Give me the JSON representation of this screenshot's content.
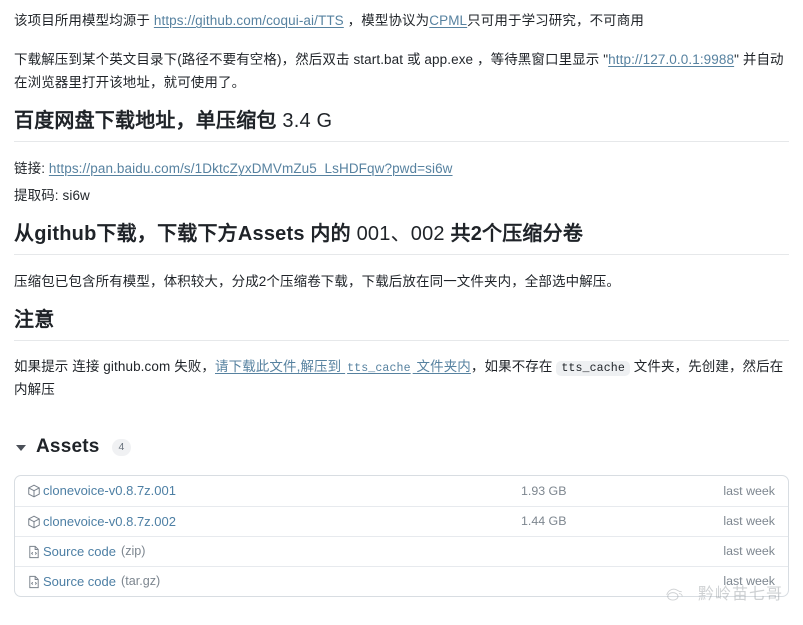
{
  "intro": {
    "line1_prefix": "该项目所用模型均源于 ",
    "line1_link1": "https://github.com/coqui-ai/TTS",
    "line1_mid": " ，模型协议为",
    "line1_link2": "CPML",
    "line1_suffix": "只可用于学习研究，不可商用",
    "line2_prefix": "下载解压到某个英文目录下(路径不要有空格)，然后双击 start.bat 或 app.exe ，等待黑窗口里显示 \"",
    "line2_link": "http://127.0.0.1:9988",
    "line2_suffix": "\" 并自动在浏览器里打开该地址，就可使用了。"
  },
  "baidu_section": {
    "heading_bold": "百度网盘下载地址，单压缩包",
    "heading_regular": " 3.4 G",
    "link_label": "链接: ",
    "link_url": "https://pan.baidu.com/s/1DktcZyxDMVmZu5_LsHDFqw?pwd=si6w",
    "code_label": "提取码: si6w"
  },
  "github_section": {
    "heading_bold_1": "从github下载，下载下方Assets 内的",
    "heading_regular": " 001、002 ",
    "heading_bold_2": "共2个压缩分卷",
    "body": "压缩包已包含所有模型，体积较大，分成2个压缩卷下载，下载后放在同一文件夹内，全部选中解压。"
  },
  "notice_section": {
    "heading": "注意",
    "body_prefix": "如果提示 连接 github.com 失败，",
    "link_text_1": "请下载此文件,解压到 ",
    "link_code": "tts_cache",
    "link_text_2": " 文件夹内",
    "body_mid": "，如果不存在 ",
    "body_code": "tts_cache",
    "body_suffix": " 文件夹，先创建，然后在内解压"
  },
  "assets": {
    "title": "Assets",
    "count": "4",
    "columns": [
      "name",
      "size",
      "date"
    ],
    "rows": [
      {
        "icon": "package-icon",
        "name": "clonevoice-v0.8.7z.001",
        "suffix": "",
        "size": "1.93 GB",
        "date": "last week"
      },
      {
        "icon": "package-icon",
        "name": "clonevoice-v0.8.7z.002",
        "suffix": "",
        "size": "1.44 GB",
        "date": "last week"
      },
      {
        "icon": "file-code-icon",
        "name": "Source code",
        "suffix": "(zip)",
        "size": "",
        "date": "last week"
      },
      {
        "icon": "file-code-icon",
        "name": "Source code",
        "suffix": "(tar.gz)",
        "size": "",
        "date": "last week"
      }
    ]
  },
  "watermark": {
    "text": "黔岭苗七哥"
  },
  "colors": {
    "link": "#5782a0",
    "asset_link": "#4d7fa4",
    "text": "#1f2328",
    "muted": "#7d868f",
    "border": "#d8dde2",
    "code_bg": "#eef0f2"
  }
}
